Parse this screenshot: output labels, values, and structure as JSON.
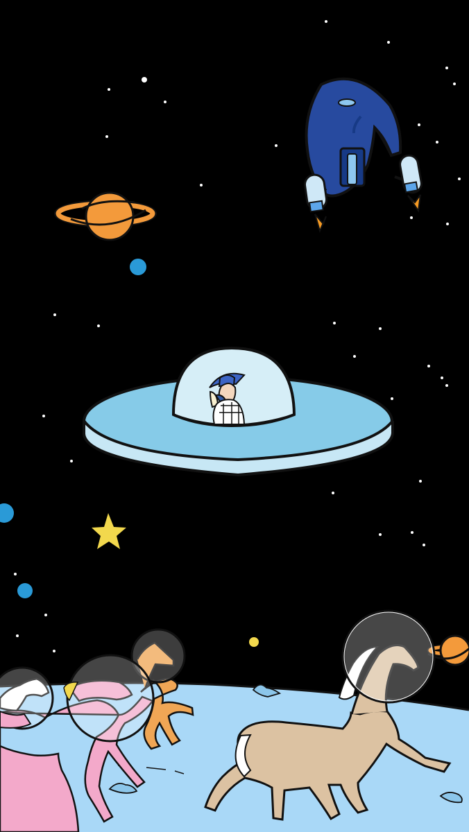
{
  "scene": {
    "background_color": "#000000",
    "star_color": "#ffffff",
    "ground_color": "#a9d8f7",
    "ground_shadow_color": "#8cc6ea",
    "ufo_color": "#86cbe8",
    "ufo_rim_color": "#c7e7f5",
    "ufo_dome_color": "#d6eef7",
    "rocket_color": "#274a9f",
    "rocket_window_color": "#8ec7ef",
    "flame_color": "#f59a23",
    "planet_color": "#f39a3b",
    "small_planet_color": "#2a9ad7",
    "star_accent_color": "#f2d84d",
    "helmet_color": "#ffffff",
    "horses": [
      {
        "name": "tan-horse",
        "color": "#dcc2a2"
      },
      {
        "name": "pink-horse",
        "color": "#f3a9ca"
      },
      {
        "name": "orange-horse",
        "color": "#f0a655"
      },
      {
        "name": "white-horse",
        "color": "#ffffff"
      }
    ]
  }
}
